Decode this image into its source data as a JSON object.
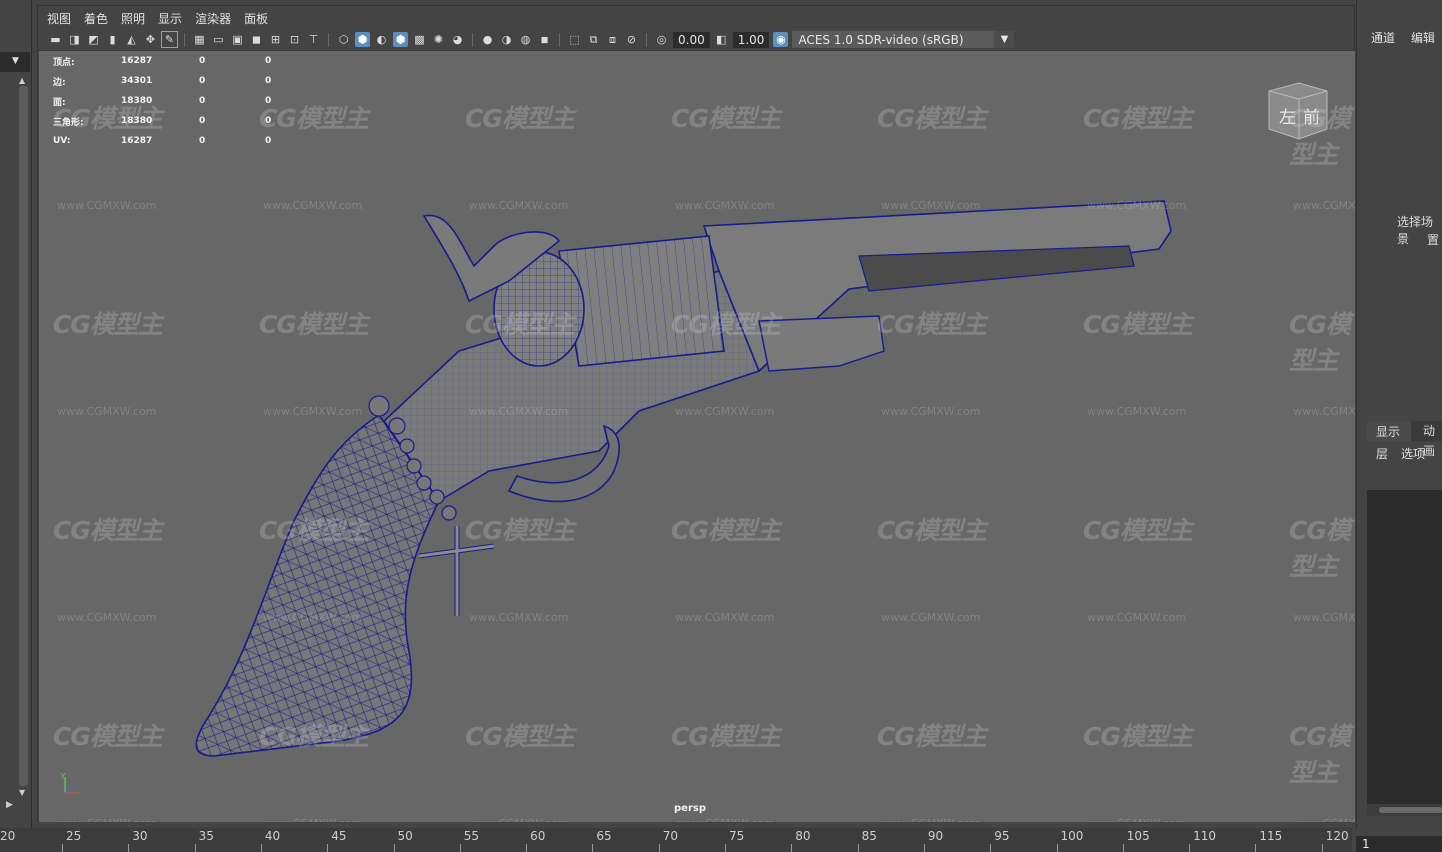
{
  "menu": {
    "items": [
      "视图",
      "着色",
      "照明",
      "显示",
      "渲染器",
      "面板"
    ]
  },
  "toolbar": {
    "exposure": "0.00",
    "gamma": "1.00",
    "color_space": "ACES 1.0 SDR-video (sRGB)"
  },
  "hud": {
    "rows": [
      {
        "label": "顶点:",
        "v1": "16287",
        "v2": "0",
        "v3": "0"
      },
      {
        "label": "边:",
        "v1": "34301",
        "v2": "0",
        "v3": "0"
      },
      {
        "label": "面:",
        "v1": "18380",
        "v2": "0",
        "v3": "0"
      },
      {
        "label": "三角形:",
        "v1": "18380",
        "v2": "0",
        "v3": "0"
      },
      {
        "label": "UV:",
        "v1": "16287",
        "v2": "0",
        "v3": "0"
      }
    ]
  },
  "viewport": {
    "camera": "persp",
    "viewcube_left": "左",
    "viewcube_front": "前",
    "wireframe_color": "#1a1a8c",
    "watermark_logo": "CG模型主",
    "watermark_url": "www.CGMXW.com"
  },
  "right_panel": {
    "tab_channels": "通道",
    "tab_edit": "编辑",
    "hint_line1": "选择场景",
    "hint_line2": "置",
    "tab_display": "显示",
    "tab_anim": "动画",
    "menu_layers": "层",
    "menu_options": "选项"
  },
  "timeline": {
    "start_label": "20",
    "labels": [
      "25",
      "30",
      "35",
      "40",
      "45",
      "50",
      "55",
      "60",
      "65",
      "70",
      "75",
      "80",
      "85",
      "90",
      "95",
      "100",
      "105",
      "110",
      "115",
      "120"
    ],
    "current_frame": "1"
  },
  "colors": {
    "viewport_bg": "#676767",
    "panel_bg": "#444444",
    "accent": "#5c8fbf"
  }
}
